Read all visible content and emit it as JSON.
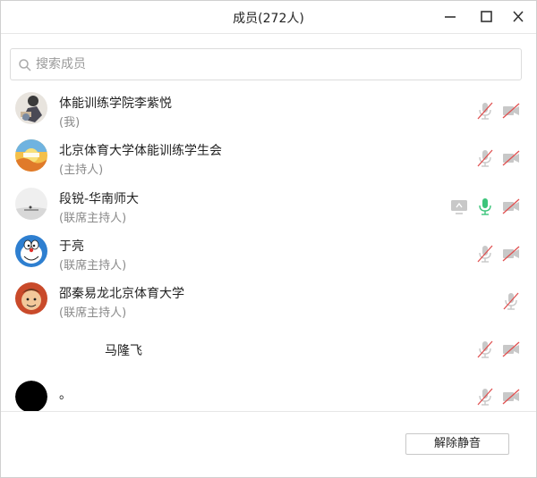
{
  "window": {
    "title": "成员(272人)",
    "controls": [
      "minimize-icon",
      "maximize-icon",
      "close-icon"
    ]
  },
  "search": {
    "placeholder": "搜索成员",
    "value": ""
  },
  "members": [
    {
      "name": "体能训练学院李紫悦",
      "role": "(我)",
      "avatar": "avatar-person-photo",
      "screen_share": false,
      "mic": "muted",
      "camera": "off"
    },
    {
      "name": "北京体育大学体能训练学生会",
      "role": "(主持人)",
      "avatar": "avatar-sunset-logo",
      "screen_share": false,
      "mic": "muted",
      "camera": "off"
    },
    {
      "name": "段锐-华南师大",
      "role": "(联席主持人)",
      "avatar": "avatar-landscape",
      "screen_share": true,
      "mic": "active",
      "camera": "off"
    },
    {
      "name": "于亮",
      "role": "(联席主持人)",
      "avatar": "avatar-doraemon",
      "screen_share": false,
      "mic": "muted",
      "camera": "off"
    },
    {
      "name": "邵秦易龙北京体育大学",
      "role": "(联席主持人)",
      "avatar": "avatar-cartoon-face",
      "screen_share": false,
      "mic": "muted",
      "camera": "none"
    },
    {
      "name": "马隆飞",
      "role": "",
      "avatar": "",
      "screen_share": false,
      "mic": "muted",
      "camera": "off"
    },
    {
      "name": "。",
      "role": "",
      "avatar": "avatar-black-circle",
      "screen_share": false,
      "mic": "muted",
      "camera": "off"
    }
  ],
  "footer": {
    "unmute_label": "解除静音"
  },
  "colors": {
    "mic_active": "#3cc47a",
    "muted_red": "#e05050",
    "icon_gray": "#c8c8c8",
    "role_text": "#8a8a8a"
  }
}
